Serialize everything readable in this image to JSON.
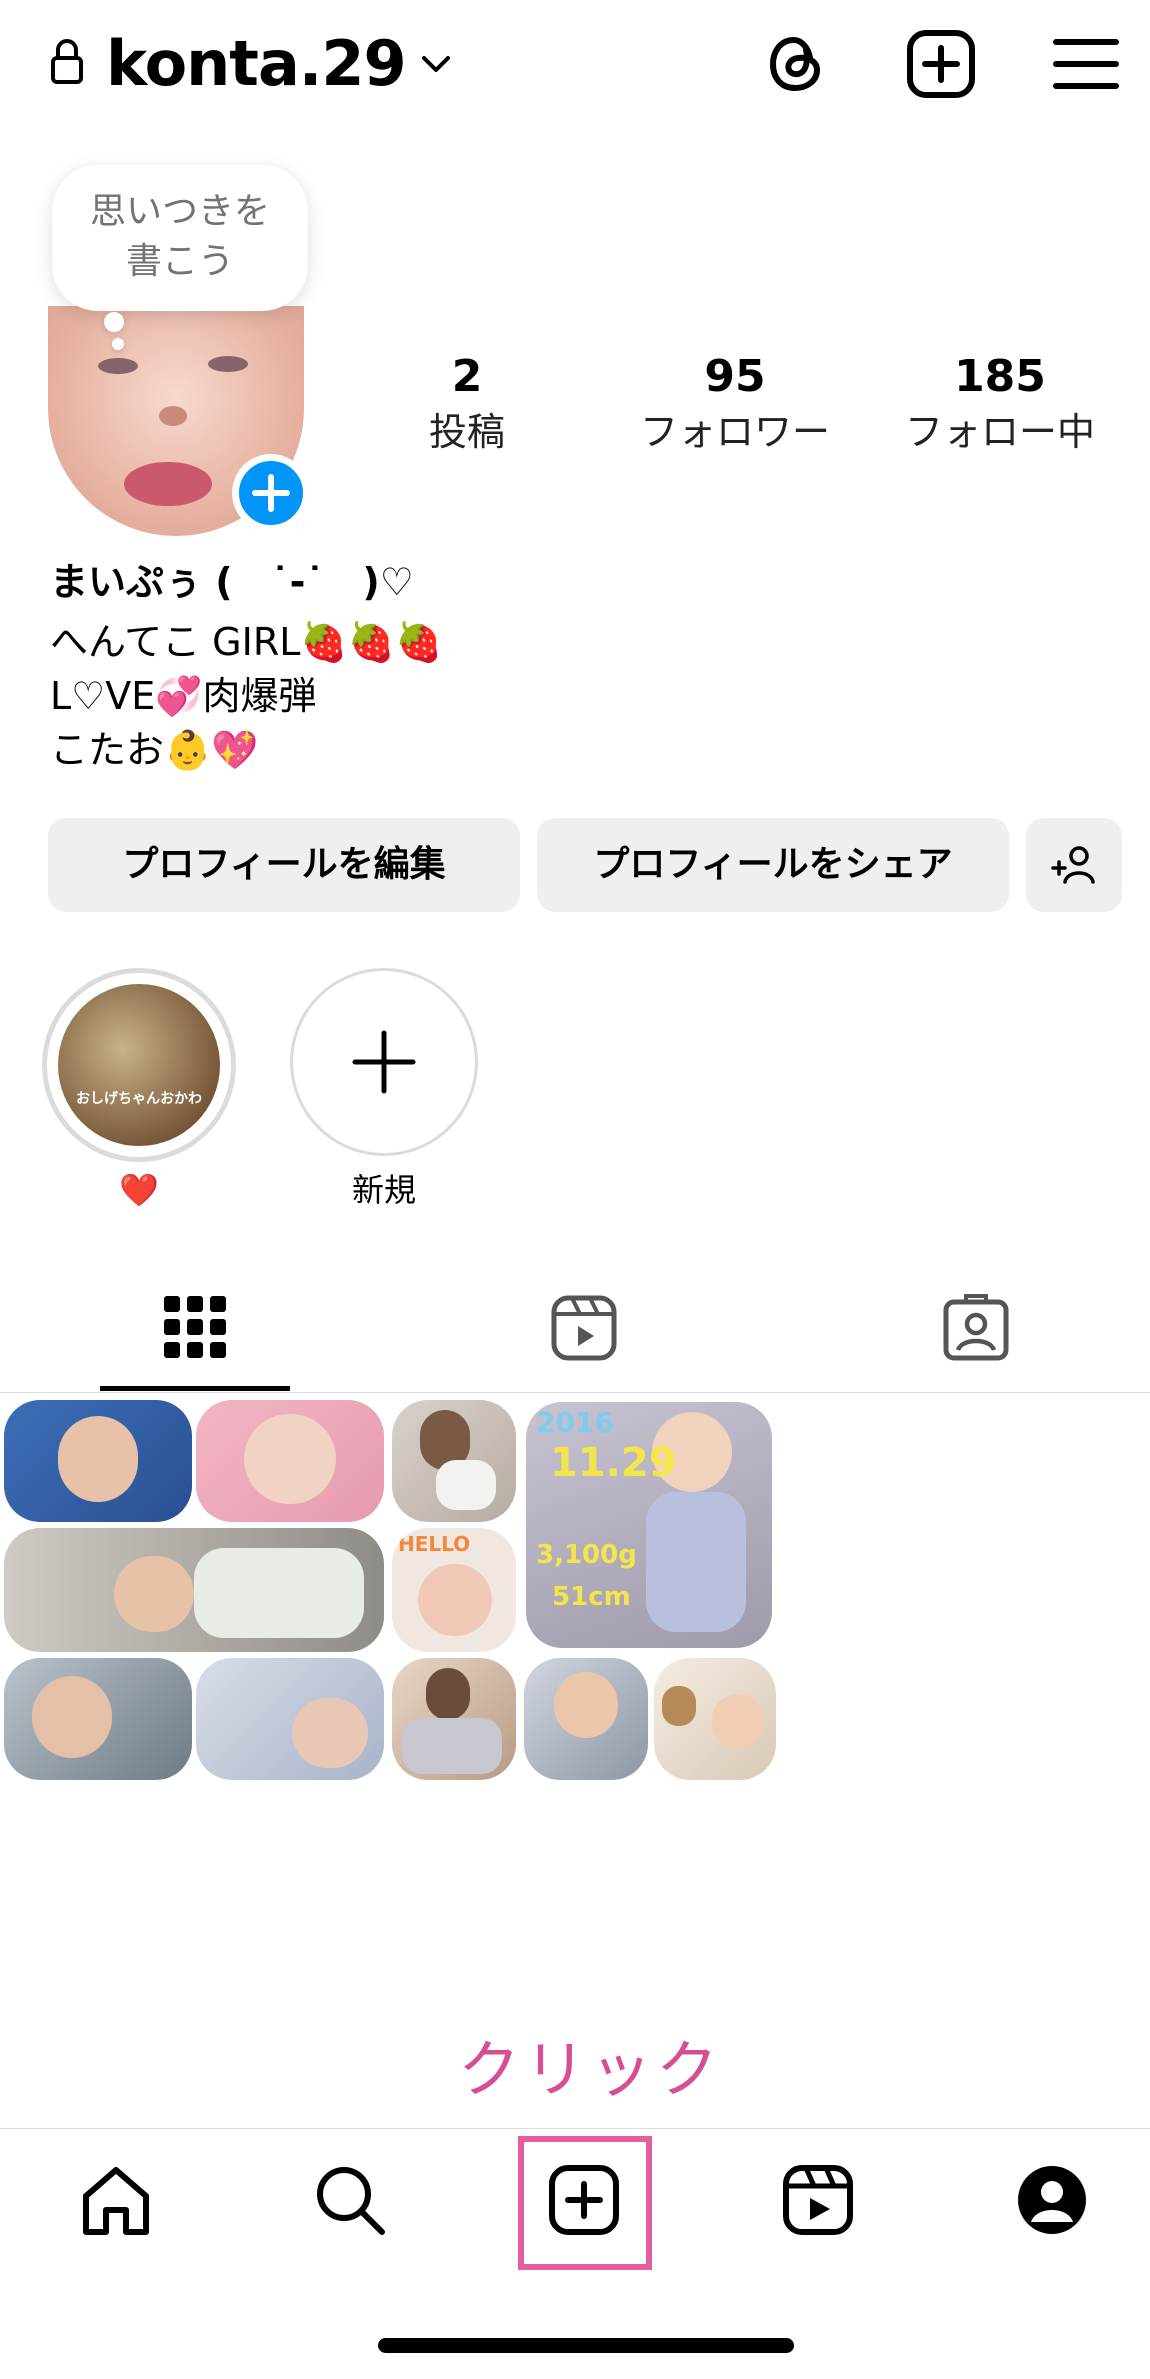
{
  "header": {
    "username": "konta.29",
    "icons": [
      "lock-icon",
      "chevron-down-icon",
      "threads-icon",
      "new-post-icon",
      "menu-icon"
    ]
  },
  "note_bubble": {
    "line1": "思いつきを",
    "line2": "書こう"
  },
  "stats": [
    {
      "value": "2",
      "label": "投稿"
    },
    {
      "value": "95",
      "label": "フォロワー"
    },
    {
      "value": "185",
      "label": "フォロー中"
    }
  ],
  "bio": {
    "name": "まいぷぅ (　˙-˙　)♡",
    "lines": [
      "へんてこ GIRL🍓🍓🍓",
      "L♡VE💞肉爆弾",
      "こたお👶💖"
    ]
  },
  "buttons": {
    "edit_profile": "プロフィールを編集",
    "share_profile": "プロフィールをシェア"
  },
  "highlights": [
    {
      "label": "❤️",
      "inner_text": "おしげちゃんおかわ"
    },
    {
      "label": "新規"
    }
  ],
  "tabs": [
    "grid-icon",
    "reels-icon",
    "tagged-icon"
  ],
  "grid_text": {
    "year": "2016",
    "date": "11.29",
    "weight": "3,100g",
    "height": "51cm",
    "hello": "HELLO"
  },
  "caption": "クリック",
  "bottom_nav": [
    "home-icon",
    "search-icon",
    "create-icon",
    "reels-icon",
    "profile-icon"
  ],
  "colors": {
    "accent_blue": "#0095f6",
    "highlight_pink": "#e35d9f",
    "caption_pink": "#d64f93"
  }
}
